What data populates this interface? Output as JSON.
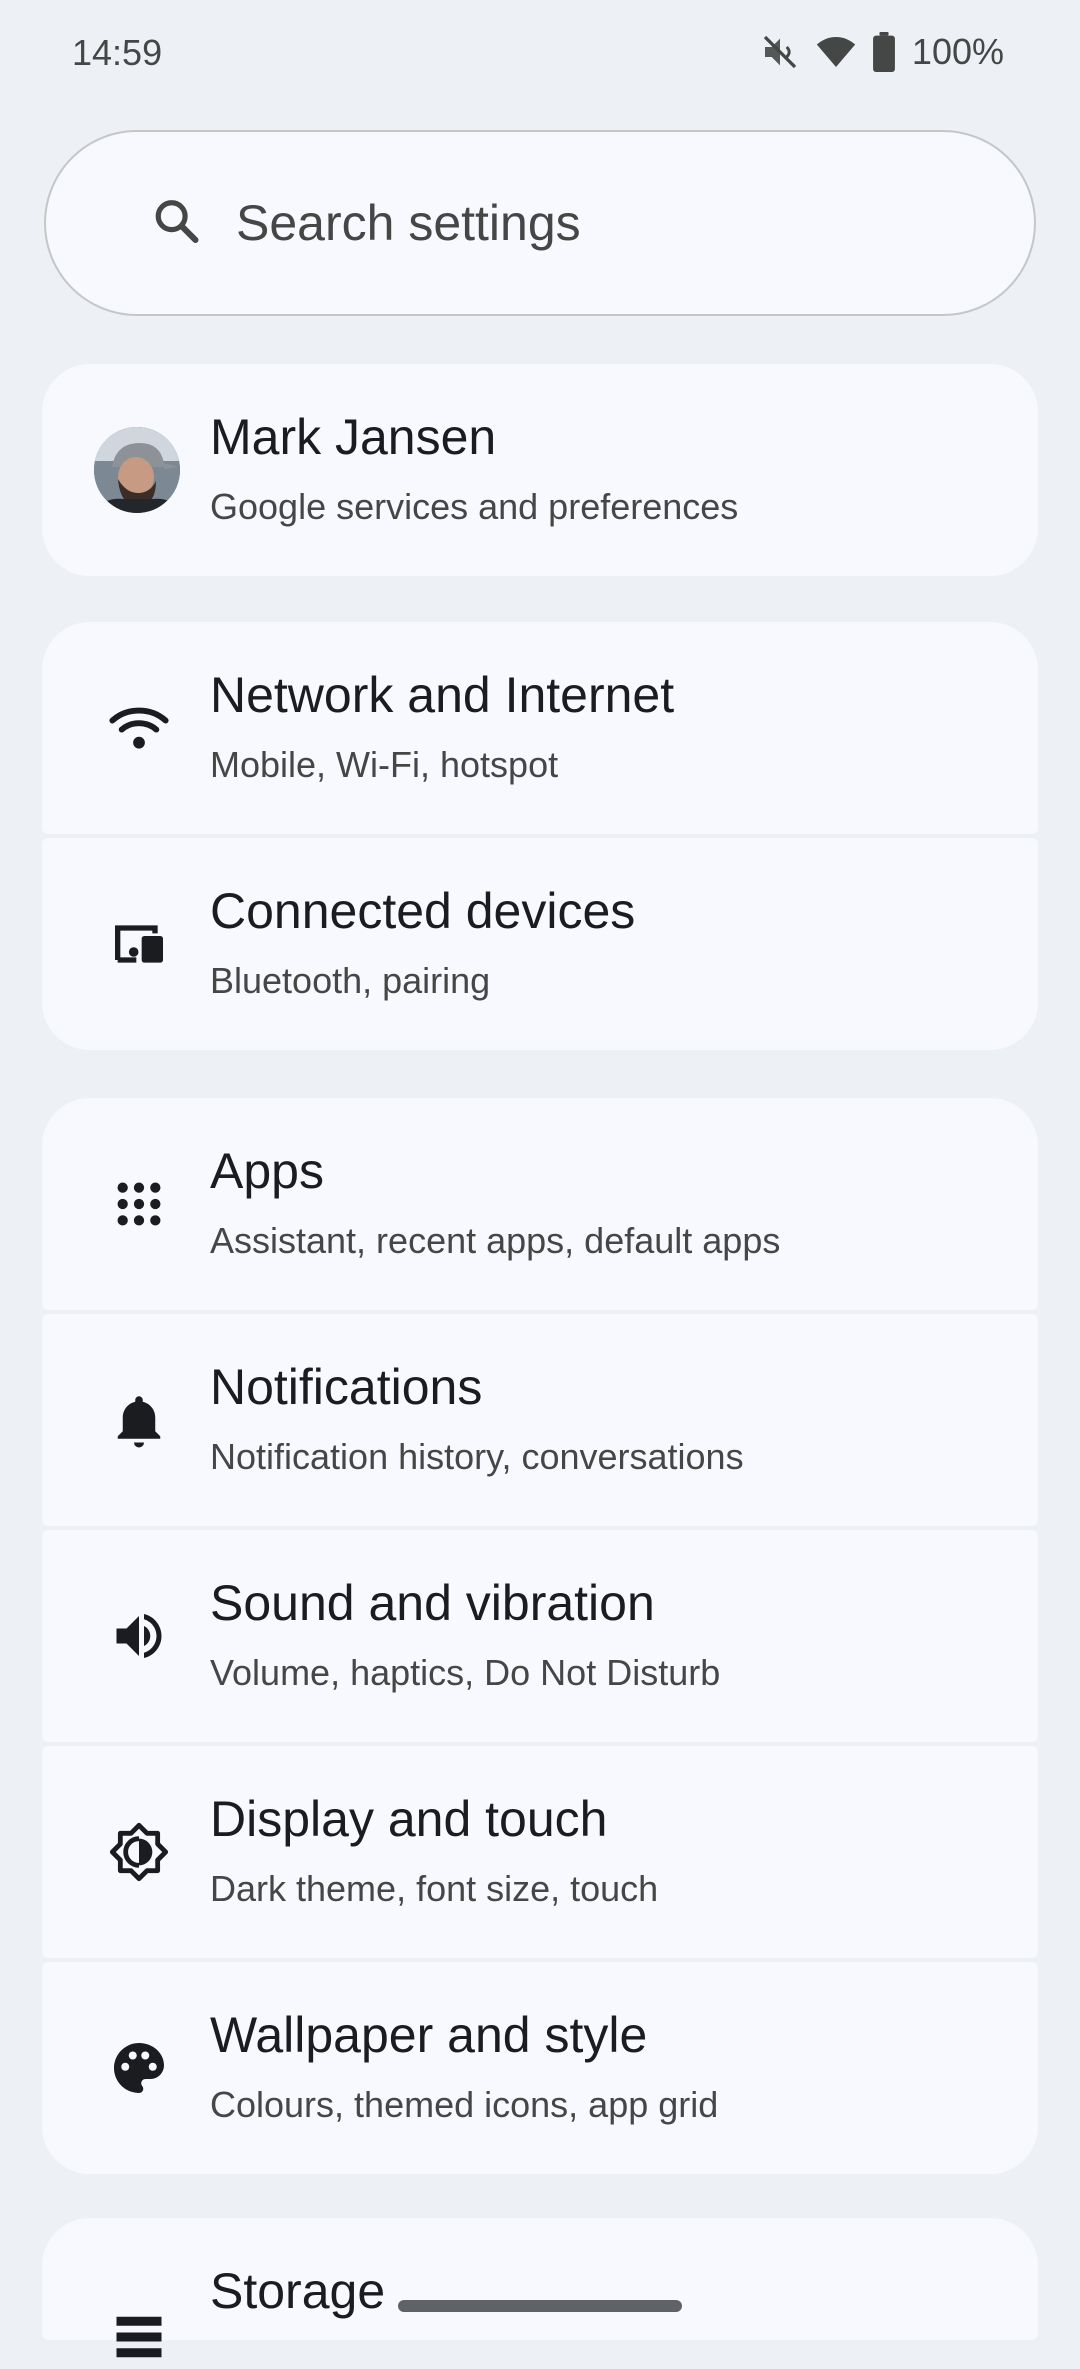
{
  "status_bar": {
    "time": "14:59",
    "battery": "100%",
    "icons": [
      "mute-vibrate-icon",
      "wifi-icon",
      "battery-icon"
    ]
  },
  "search": {
    "placeholder": "Search settings"
  },
  "account": {
    "name": "Mark Jansen",
    "subtitle": "Google services and preferences"
  },
  "settings": [
    {
      "id": "network",
      "icon": "wifi-icon",
      "title": "Network and Internet",
      "subtitle": "Mobile, Wi-Fi, hotspot"
    },
    {
      "id": "connected",
      "icon": "connected-devices-icon",
      "title": "Connected devices",
      "subtitle": "Bluetooth, pairing"
    },
    {
      "id": "apps",
      "icon": "apps-grid-icon",
      "title": "Apps",
      "subtitle": "Assistant, recent apps, default apps"
    },
    {
      "id": "notifications",
      "icon": "bell-icon",
      "title": "Notifications",
      "subtitle": "Notification history, conversations"
    },
    {
      "id": "sound",
      "icon": "speaker-icon",
      "title": "Sound and vibration",
      "subtitle": "Volume, haptics, Do Not Disturb"
    },
    {
      "id": "display",
      "icon": "brightness-icon",
      "title": "Display and touch",
      "subtitle": "Dark theme, font size, touch"
    },
    {
      "id": "wallpaper",
      "icon": "palette-icon",
      "title": "Wallpaper and style",
      "subtitle": "Colours, themed icons, app grid"
    },
    {
      "id": "storage",
      "icon": "storage-icon",
      "title": "Storage",
      "subtitle": ""
    }
  ],
  "colors": {
    "background": "#edf0f5",
    "card": "#f7f9fe",
    "title_text": "#1b1c1f",
    "secondary_text": "#444746"
  }
}
